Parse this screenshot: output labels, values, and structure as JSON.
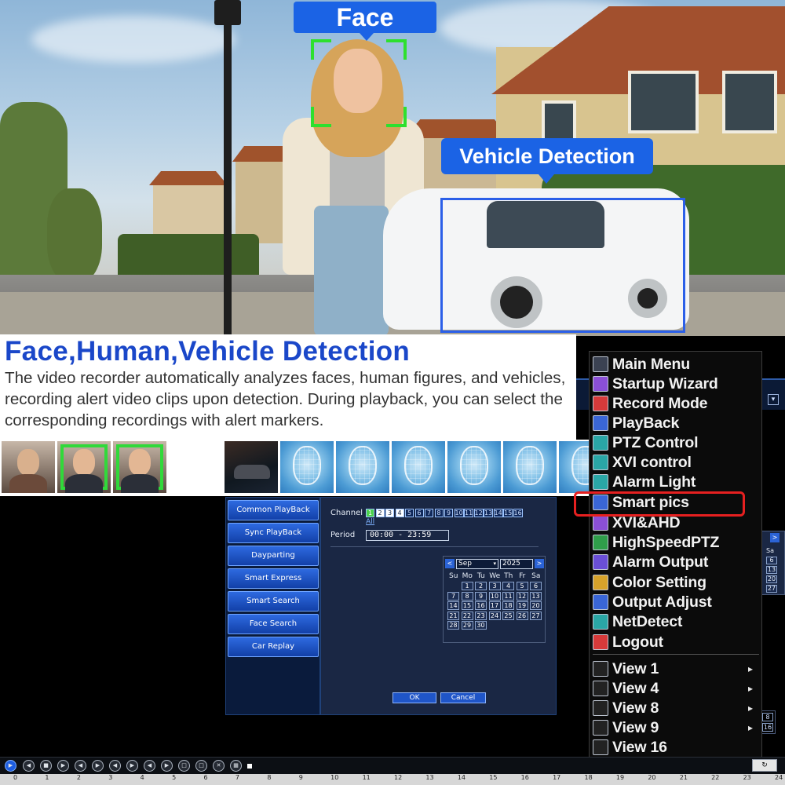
{
  "hero": {
    "face_label": "Face",
    "vehicle_label": "Vehicle Detection"
  },
  "intro": {
    "headline": "Face,Human,Vehicle Detection",
    "description": "The video recorder automatically analyzes faces, human figures, and vehicles, recording alert video clips upon detection. During playback, you can select the corresponding recordings with alert markers."
  },
  "playback_menu": {
    "buttons": [
      "Common PlayBack",
      "Sync PlayBack",
      "Dayparting",
      "Smart Express",
      "Smart Search",
      "Face Search",
      "Car Replay"
    ]
  },
  "search_form": {
    "channel_label": "Channel",
    "channels": [
      "1",
      "2",
      "3",
      "4",
      "5",
      "6",
      "7",
      "8",
      "9",
      "10",
      "11",
      "12",
      "13",
      "14",
      "15",
      "16"
    ],
    "all_label": "All",
    "period_label": "Period",
    "period_value": "00:00  -  23:59",
    "ok_label": "OK",
    "cancel_label": "Cancel"
  },
  "calendar": {
    "month": "Sep",
    "year": "2025",
    "weekdays": [
      "Su",
      "Mo",
      "Tu",
      "We",
      "Th",
      "Fr",
      "Sa"
    ],
    "days": [
      "1",
      "2",
      "3",
      "4",
      "5",
      "6",
      "7",
      "8",
      "9",
      "10",
      "11",
      "12",
      "13",
      "14",
      "15",
      "16",
      "17",
      "18",
      "19",
      "20",
      "21",
      "22",
      "23",
      "24",
      "25",
      "26",
      "27",
      "28",
      "29",
      "30"
    ]
  },
  "partial_calendar": {
    "weekday": "Sa",
    "days": [
      "6",
      "13",
      "20",
      "27"
    ],
    "frame_items": [
      "8",
      "16"
    ]
  },
  "main_menu": {
    "items": [
      "Main Menu",
      "Startup Wizard",
      "Record Mode",
      "PlayBack",
      "PTZ Control",
      "XVI control",
      "Alarm Light",
      "Smart pics",
      "XVI&AHD",
      "HighSpeedPTZ",
      "Alarm Output",
      "Color Setting",
      "Output Adjust",
      "NetDetect",
      "Logout"
    ],
    "view_items": [
      "View 1",
      "View 4",
      "View 8",
      "View 9",
      "View 16"
    ],
    "highlighted": "Smart pics"
  },
  "timeline": {
    "ticks": [
      "0",
      "1",
      "2",
      "3",
      "4",
      "5",
      "6",
      "7",
      "8",
      "9",
      "10",
      "11",
      "12",
      "13",
      "14",
      "15",
      "16",
      "17",
      "18",
      "19",
      "20",
      "21",
      "22",
      "23",
      "24"
    ]
  },
  "colors": {
    "accent_blue": "#1b63e5",
    "headline_blue": "#1a47c9",
    "detection_green": "#2ee02e",
    "highlight_red": "#e62020"
  }
}
